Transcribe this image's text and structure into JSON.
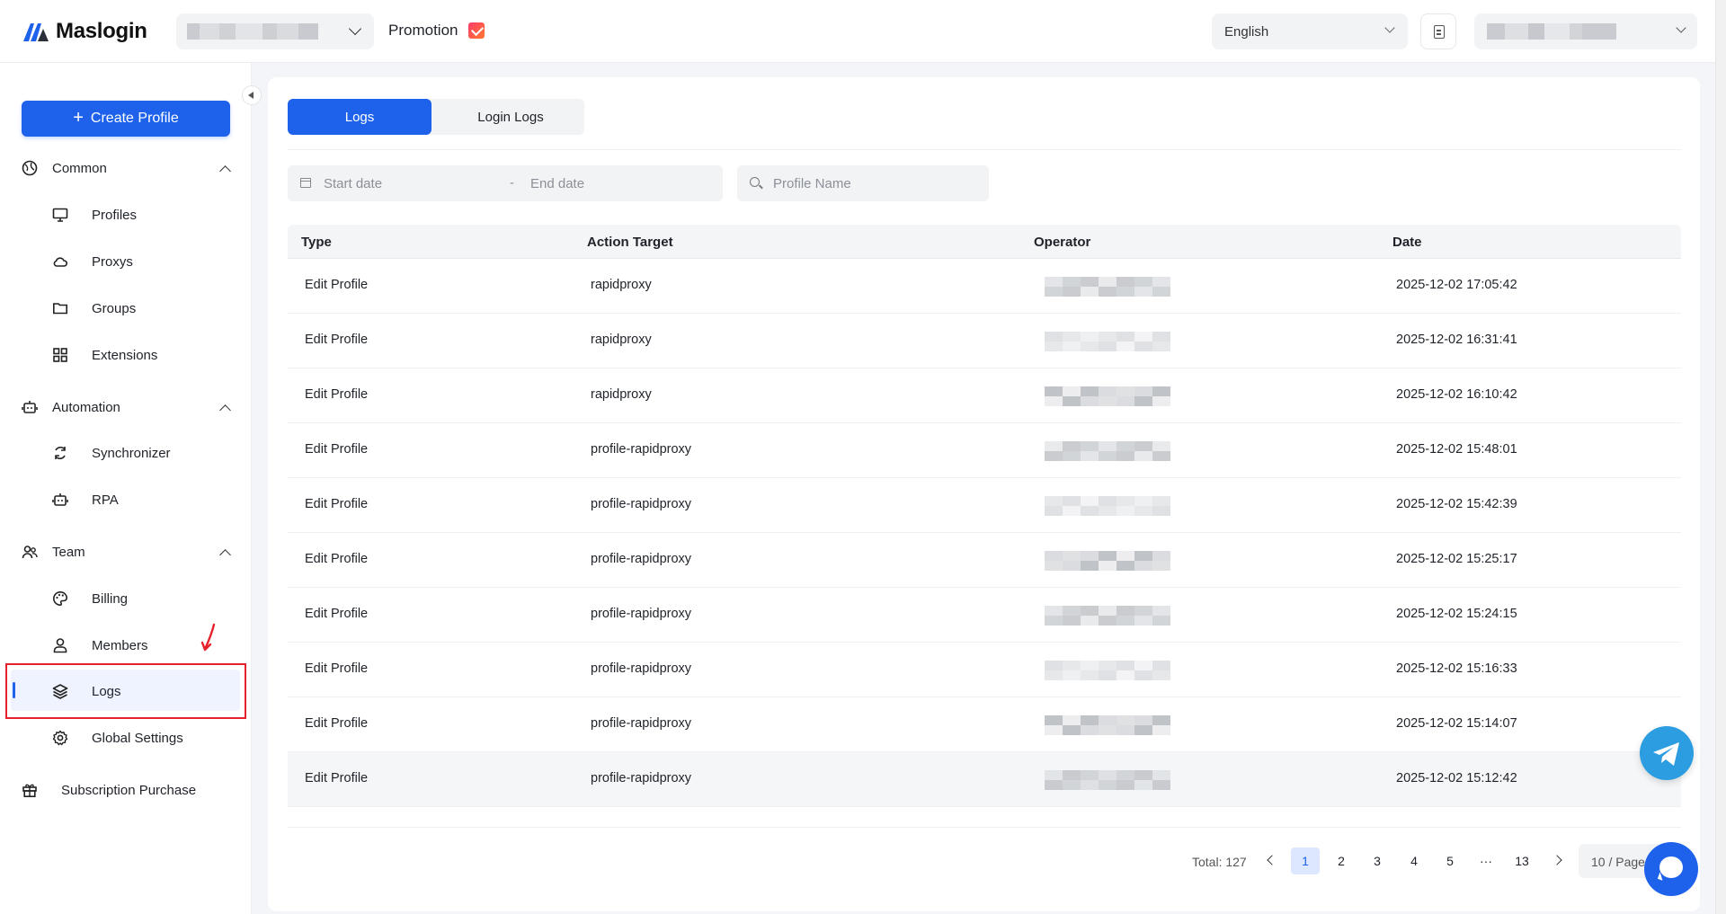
{
  "header": {
    "brand": "Maslogin",
    "promotion_label": "Promotion",
    "language": "English"
  },
  "sidebar": {
    "create_button": "Create Profile",
    "groups": [
      {
        "label": "Common",
        "items": [
          "Profiles",
          "Proxys",
          "Groups",
          "Extensions"
        ]
      },
      {
        "label": "Automation",
        "items": [
          "Synchronizer",
          "RPA"
        ]
      },
      {
        "label": "Team",
        "items": [
          "Billing",
          "Members",
          "Logs",
          "Global Settings"
        ]
      }
    ],
    "subscription": "Subscription Purchase",
    "active_item": "Logs"
  },
  "main": {
    "tabs": [
      {
        "label": "Logs",
        "active": true
      },
      {
        "label": "Login Logs",
        "active": false
      }
    ],
    "filters": {
      "start_placeholder": "Start date",
      "separator": "-",
      "end_placeholder": "End date",
      "profile_placeholder": "Profile Name"
    },
    "table": {
      "columns": [
        "Type",
        "Action Target",
        "Operator",
        "Date"
      ],
      "rows": [
        {
          "type": "Edit Profile",
          "target": "rapidproxy",
          "date": "2025-12-02 17:05:42"
        },
        {
          "type": "Edit Profile",
          "target": "rapidproxy",
          "date": "2025-12-02 16:31:41"
        },
        {
          "type": "Edit Profile",
          "target": "rapidproxy",
          "date": "2025-12-02 16:10:42"
        },
        {
          "type": "Edit Profile",
          "target": "profile-rapidproxy",
          "date": "2025-12-02 15:48:01"
        },
        {
          "type": "Edit Profile",
          "target": "profile-rapidproxy",
          "date": "2025-12-02 15:42:39"
        },
        {
          "type": "Edit Profile",
          "target": "profile-rapidproxy",
          "date": "2025-12-02 15:25:17"
        },
        {
          "type": "Edit Profile",
          "target": "profile-rapidproxy",
          "date": "2025-12-02 15:24:15"
        },
        {
          "type": "Edit Profile",
          "target": "profile-rapidproxy",
          "date": "2025-12-02 15:16:33"
        },
        {
          "type": "Edit Profile",
          "target": "profile-rapidproxy",
          "date": "2025-12-02 15:14:07"
        },
        {
          "type": "Edit Profile",
          "target": "profile-rapidproxy",
          "date": "2025-12-02 15:12:42"
        }
      ]
    },
    "pagination": {
      "total": "Total: 127",
      "pages": [
        "1",
        "2",
        "3",
        "4",
        "5",
        "···",
        "13"
      ],
      "current": "1",
      "page_size": "10 / Page"
    }
  },
  "colors": {
    "accent": "#1e62ec",
    "highlight_box": "#e5222b",
    "telegram": "#2b9de0"
  },
  "icons": {
    "common": "globe-icon",
    "profiles": "monitor-icon",
    "proxys": "cloud-icon",
    "groups": "folder-icon",
    "extensions": "grid-icon",
    "automation": "robot-icon",
    "synchronizer": "sync-icon",
    "rpa": "robot-icon",
    "team": "team-icon",
    "billing": "palette-icon",
    "members": "user-icon",
    "logs": "layers-icon",
    "global_settings": "gear-icon",
    "subscription": "gift-icon"
  }
}
